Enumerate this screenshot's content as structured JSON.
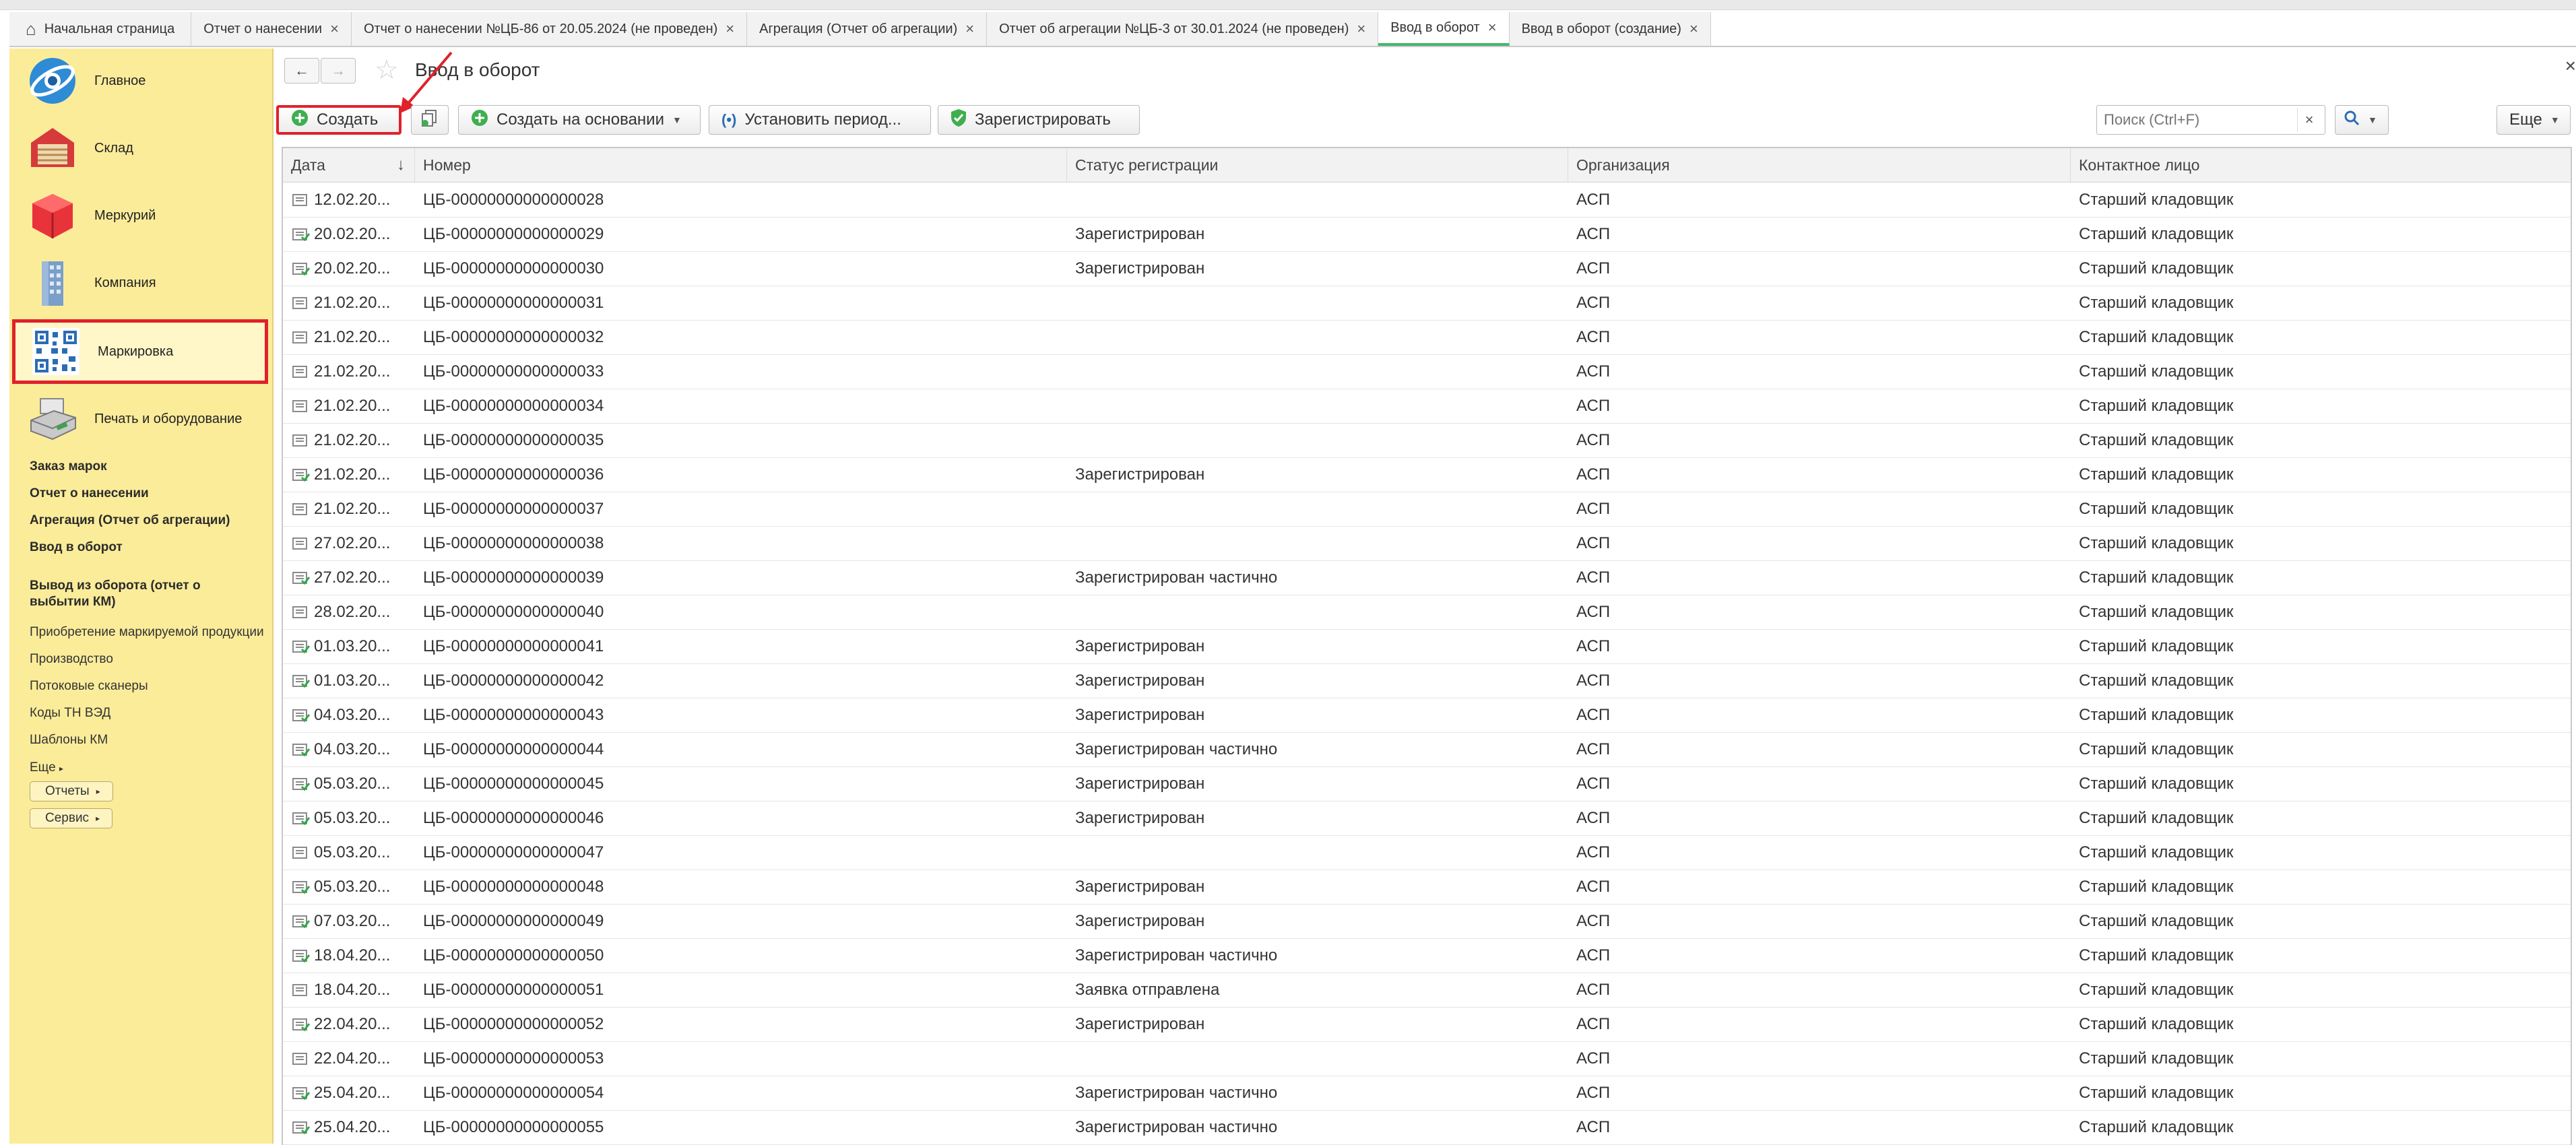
{
  "tabs": [
    {
      "label": "Начальная страница",
      "home": true
    },
    {
      "label": "Отчет о нанесении"
    },
    {
      "label": "Отчет о нанесении №ЦБ-86 от 20.05.2024 (не проведен)"
    },
    {
      "label": "Агрегация (Отчет об агрегации)"
    },
    {
      "label": "Отчет об агрегации №ЦБ-3 от 30.01.2024 (не проведен)"
    },
    {
      "label": "Ввод в оборот",
      "active": true
    },
    {
      "label": "Ввод в оборот (создание)"
    }
  ],
  "sidebar": {
    "sections": [
      {
        "label": "Главное",
        "icon": "main-logo-icon"
      },
      {
        "label": "Склад",
        "icon": "warehouse-icon"
      },
      {
        "label": "Меркурий",
        "icon": "mercury-box-icon"
      },
      {
        "label": "Компания",
        "icon": "building-icon"
      },
      {
        "label": "Маркировка",
        "icon": "qr-code-icon",
        "selected": true
      },
      {
        "label": "Печать и оборудование",
        "icon": "printer-icon"
      }
    ],
    "links": [
      {
        "label": "Заказ марок",
        "bold": true
      },
      {
        "label": "Отчет о нанесении",
        "bold": true
      },
      {
        "label": "Агрегация (Отчет об агрегации)",
        "bold": true
      },
      {
        "label": "Ввод в оборот",
        "bold": true
      },
      {
        "label": "Вывод из оборота (отчет о выбытии КМ)",
        "bold": true
      },
      {
        "label": "Приобретение маркируемой продукции",
        "bold": false
      },
      {
        "label": "Производство",
        "bold": false
      },
      {
        "label": "Потоковые сканеры",
        "bold": false
      },
      {
        "label": "Коды ТН ВЭД",
        "bold": false
      },
      {
        "label": "Шаблоны КМ",
        "bold": false
      }
    ],
    "more": "Еще",
    "reports": "Отчеты",
    "service": "Сервис"
  },
  "main": {
    "title": "Ввод в оборот",
    "toolbar": {
      "create": "Создать",
      "create_based": "Создать на основании",
      "set_period": "Установить период...",
      "register": "Зарегистрировать",
      "more": "Еще"
    },
    "search_placeholder": "Поиск (Ctrl+F)"
  },
  "table": {
    "columns": [
      "Дата",
      "Номер",
      "Статус регистрации",
      "Организация",
      "Контактное лицо"
    ],
    "rows": [
      {
        "date": "12.02.20...",
        "number": "ЦБ-00000000000000028",
        "status": "",
        "org": "АСП",
        "contact": "Старший кладовщик",
        "posted": false
      },
      {
        "date": "20.02.20...",
        "number": "ЦБ-00000000000000029",
        "status": "Зарегистрирован",
        "org": "АСП",
        "contact": "Старший кладовщик",
        "posted": true
      },
      {
        "date": "20.02.20...",
        "number": "ЦБ-00000000000000030",
        "status": "Зарегистрирован",
        "org": "АСП",
        "contact": "Старший кладовщик",
        "posted": true
      },
      {
        "date": "21.02.20...",
        "number": "ЦБ-00000000000000031",
        "status": "",
        "org": "АСП",
        "contact": "Старший кладовщик",
        "posted": false
      },
      {
        "date": "21.02.20...",
        "number": "ЦБ-00000000000000032",
        "status": "",
        "org": "АСП",
        "contact": "Старший кладовщик",
        "posted": false
      },
      {
        "date": "21.02.20...",
        "number": "ЦБ-00000000000000033",
        "status": "",
        "org": "АСП",
        "contact": "Старший кладовщик",
        "posted": false
      },
      {
        "date": "21.02.20...",
        "number": "ЦБ-00000000000000034",
        "status": "",
        "org": "АСП",
        "contact": "Старший кладовщик",
        "posted": false
      },
      {
        "date": "21.02.20...",
        "number": "ЦБ-00000000000000035",
        "status": "",
        "org": "АСП",
        "contact": "Старший кладовщик",
        "posted": false
      },
      {
        "date": "21.02.20...",
        "number": "ЦБ-00000000000000036",
        "status": "Зарегистрирован",
        "org": "АСП",
        "contact": "Старший кладовщик",
        "posted": true
      },
      {
        "date": "21.02.20...",
        "number": "ЦБ-00000000000000037",
        "status": "",
        "org": "АСП",
        "contact": "Старший кладовщик",
        "posted": false
      },
      {
        "date": "27.02.20...",
        "number": "ЦБ-00000000000000038",
        "status": "",
        "org": "АСП",
        "contact": "Старший кладовщик",
        "posted": false
      },
      {
        "date": "27.02.20...",
        "number": "ЦБ-00000000000000039",
        "status": "Зарегистрирован частично",
        "org": "АСП",
        "contact": "Старший кладовщик",
        "posted": true
      },
      {
        "date": "28.02.20...",
        "number": "ЦБ-00000000000000040",
        "status": "",
        "org": "АСП",
        "contact": "Старший кладовщик",
        "posted": false
      },
      {
        "date": "01.03.20...",
        "number": "ЦБ-00000000000000041",
        "status": "Зарегистрирован",
        "org": "АСП",
        "contact": "Старший кладовщик",
        "posted": true
      },
      {
        "date": "01.03.20...",
        "number": "ЦБ-00000000000000042",
        "status": "Зарегистрирован",
        "org": "АСП",
        "contact": "Старший кладовщик",
        "posted": true
      },
      {
        "date": "04.03.20...",
        "number": "ЦБ-00000000000000043",
        "status": "Зарегистрирован",
        "org": "АСП",
        "contact": "Старший кладовщик",
        "posted": true
      },
      {
        "date": "04.03.20...",
        "number": "ЦБ-00000000000000044",
        "status": "Зарегистрирован частично",
        "org": "АСП",
        "contact": "Старший кладовщик",
        "posted": true
      },
      {
        "date": "05.03.20...",
        "number": "ЦБ-00000000000000045",
        "status": "Зарегистрирован",
        "org": "АСП",
        "contact": "Старший кладовщик",
        "posted": true
      },
      {
        "date": "05.03.20...",
        "number": "ЦБ-00000000000000046",
        "status": "Зарегистрирован",
        "org": "АСП",
        "contact": "Старший кладовщик",
        "posted": true
      },
      {
        "date": "05.03.20...",
        "number": "ЦБ-00000000000000047",
        "status": "",
        "org": "АСП",
        "contact": "Старший кладовщик",
        "posted": false
      },
      {
        "date": "05.03.20...",
        "number": "ЦБ-00000000000000048",
        "status": "Зарегистрирован",
        "org": "АСП",
        "contact": "Старший кладовщик",
        "posted": true
      },
      {
        "date": "07.03.20...",
        "number": "ЦБ-00000000000000049",
        "status": "Зарегистрирован",
        "org": "АСП",
        "contact": "Старший кладовщик",
        "posted": true
      },
      {
        "date": "18.04.20...",
        "number": "ЦБ-00000000000000050",
        "status": "Зарегистрирован частично",
        "org": "АСП",
        "contact": "Старший кладовщик",
        "posted": true
      },
      {
        "date": "18.04.20...",
        "number": "ЦБ-00000000000000051",
        "status": "Заявка отправлена",
        "org": "АСП",
        "contact": "Старший кладовщик",
        "posted": false
      },
      {
        "date": "22.04.20...",
        "number": "ЦБ-00000000000000052",
        "status": "Зарегистрирован",
        "org": "АСП",
        "contact": "Старший кладовщик",
        "posted": true
      },
      {
        "date": "22.04.20...",
        "number": "ЦБ-00000000000000053",
        "status": "",
        "org": "АСП",
        "contact": "Старший кладовщик",
        "posted": false
      },
      {
        "date": "25.04.20...",
        "number": "ЦБ-00000000000000054",
        "status": "Зарегистрирован частично",
        "org": "АСП",
        "contact": "Старший кладовщик",
        "posted": true
      },
      {
        "date": "25.04.20...",
        "number": "ЦБ-00000000000000055",
        "status": "Зарегистрирован частично",
        "org": "АСП",
        "contact": "Старший кладовщик",
        "posted": true
      }
    ]
  },
  "colors": {
    "sidebar_bg": "#fbec9a",
    "highlight_red": "#e0212a",
    "accent_green": "#41b86e"
  }
}
